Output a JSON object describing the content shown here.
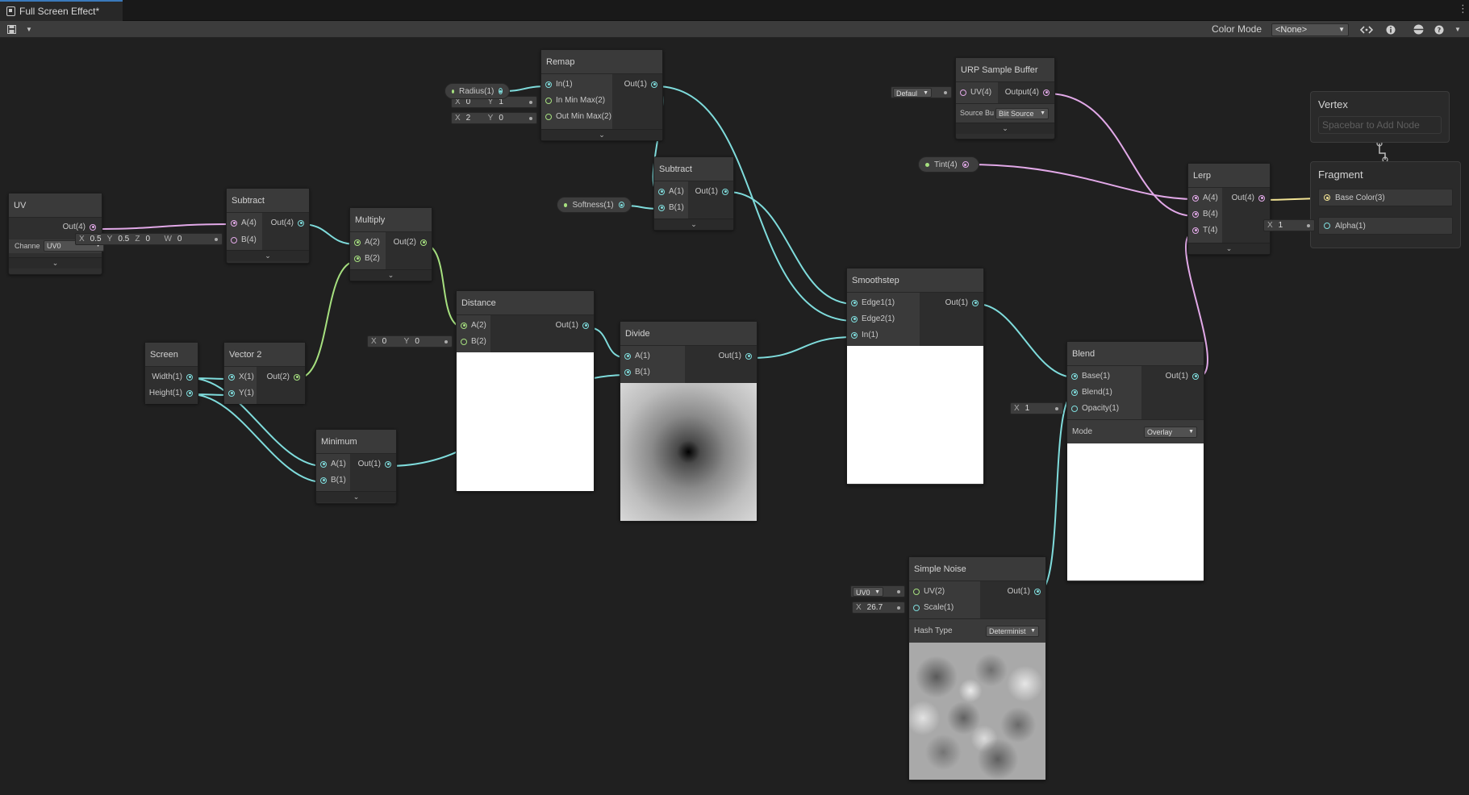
{
  "window": {
    "tab_title": "Full Screen Effect*"
  },
  "toolbar": {
    "color_mode_label": "Color Mode",
    "color_mode_value": "<None>"
  },
  "nodes": {
    "uv": {
      "title": "UV",
      "out": "Out(4)",
      "channel_label": "Channe",
      "channel_value": "UV0"
    },
    "subtract1": {
      "title": "Subtract",
      "in_a": "A(4)",
      "in_b": "B(4)",
      "out": "Out(4)",
      "b_x_lbl": "X",
      "b_x": "0.5",
      "b_y_lbl": "Y",
      "b_y": "0.5",
      "b_z_lbl": "Z",
      "b_z": "0",
      "b_w_lbl": "W",
      "b_w": "0"
    },
    "multiply": {
      "title": "Multiply",
      "in_a": "A(2)",
      "in_b": "B(2)",
      "out": "Out(2)"
    },
    "screen": {
      "title": "Screen",
      "out_w": "Width(1)",
      "out_h": "Height(1)"
    },
    "vector2": {
      "title": "Vector 2",
      "in_x": "X(1)",
      "in_y": "Y(1)",
      "out": "Out(2)"
    },
    "minimum": {
      "title": "Minimum",
      "in_a": "A(1)",
      "in_b": "B(1)",
      "out": "Out(1)"
    },
    "distance": {
      "title": "Distance",
      "in_a": "A(2)",
      "in_b": "B(2)",
      "out": "Out(1)",
      "b_x_lbl": "X",
      "b_x": "0",
      "b_y_lbl": "Y",
      "b_y": "0"
    },
    "remap": {
      "title": "Remap",
      "in_in": "In(1)",
      "in_min": "In Min Max(2)",
      "out_min": "Out Min Max(2)",
      "out": "Out(1)",
      "inmm_x_lbl": "X",
      "inmm_x": "0",
      "inmm_y_lbl": "Y",
      "inmm_y": "1",
      "outmm_x_lbl": "X",
      "outmm_x": "2",
      "outmm_y_lbl": "Y",
      "outmm_y": "0"
    },
    "subtract2": {
      "title": "Subtract",
      "in_a": "A(1)",
      "in_b": "B(1)",
      "out": "Out(1)"
    },
    "divide": {
      "title": "Divide",
      "in_a": "A(1)",
      "in_b": "B(1)",
      "out": "Out(1)"
    },
    "smoothstep": {
      "title": "Smoothstep",
      "in_e1": "Edge1(1)",
      "in_e2": "Edge2(1)",
      "in_in": "In(1)",
      "out": "Out(1)"
    },
    "urp": {
      "title": "URP Sample Buffer",
      "in_uv": "UV(4)",
      "out": "Output(4)",
      "uv_default": "Defaul",
      "source_label": "Source Bu",
      "source_value": "Blit Source"
    },
    "lerp": {
      "title": "Lerp",
      "in_a": "A(4)",
      "in_b": "B(4)",
      "in_t": "T(4)",
      "out": "Out(4)"
    },
    "blend": {
      "title": "Blend",
      "in_base": "Base(1)",
      "in_blend": "Blend(1)",
      "in_op": "Opacity(1)",
      "out": "Out(1)",
      "mode_label": "Mode",
      "mode_value": "Overlay",
      "op_x_lbl": "X",
      "op_x": "1"
    },
    "noise": {
      "title": "Simple Noise",
      "in_uv": "UV(2)",
      "in_scale": "Scale(1)",
      "out": "Out(1)",
      "uv_default": "UV0",
      "scale_x_lbl": "X",
      "scale_x": "26.7",
      "hash_label": "Hash Type",
      "hash_value": "Determinist"
    }
  },
  "properties": {
    "radius": "Radius(1)",
    "softness": "Softness(1)",
    "tint": "Tint(4)"
  },
  "master": {
    "vertex_title": "Vertex",
    "vertex_hint": "Spacebar to Add Node",
    "fragment_title": "Fragment",
    "base_color": "Base Color(3)",
    "alpha": "Alpha(1)",
    "alpha_x_lbl": "X",
    "alpha_x": "1"
  },
  "colors": {
    "float": "#7fdcdc",
    "vector4": "#e2a9e8",
    "vector2": "#a6e07f",
    "vector3": "#f2e394",
    "graph_bg": "#202020"
  }
}
